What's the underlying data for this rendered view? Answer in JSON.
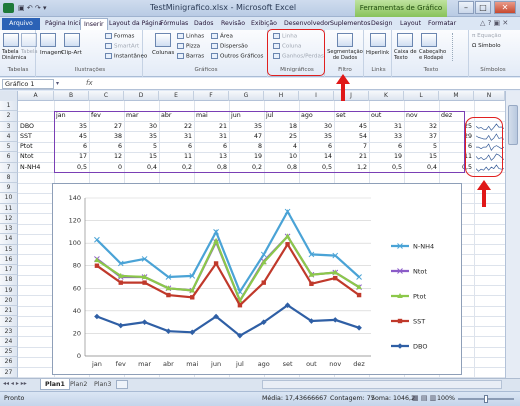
{
  "window": {
    "title": "TestMinigrafico.xlsx - Microsoft Excel",
    "context_tab": "Ferramentas de Gráfico",
    "minimize": "–",
    "maximize": "□",
    "close": "✕"
  },
  "tabs": [
    "Arquivo",
    "Página Inicial",
    "Inserir",
    "Layout da Página",
    "Fórmulas",
    "Dados",
    "Revisão",
    "Exibição",
    "Desenvolvedor",
    "Suplementos",
    "Design",
    "Layout",
    "Formatar"
  ],
  "ribbon": {
    "tabelas": {
      "label": "Tabelas",
      "items": [
        "Tabela Dinâmica",
        "Tabela"
      ]
    },
    "ilustracoes": {
      "label": "Ilustrações",
      "items": [
        "Imagem",
        "Clip-Art",
        "Formas",
        "SmartArt",
        "Instantâneo"
      ]
    },
    "graficos": {
      "label": "Gráficos",
      "items": [
        "Colunas",
        "Linhas",
        "Pizza",
        "Barras",
        "Área",
        "Dispersão",
        "Outros Gráficos"
      ]
    },
    "minigraficos": {
      "label": "Minigráficos",
      "items": [
        "Linha",
        "Coluna",
        "Ganhos/Perdas"
      ]
    },
    "filtro": {
      "label": "Filtro",
      "items": [
        "Segmentação de Dados"
      ]
    },
    "links": {
      "label": "Links",
      "items": [
        "Hiperlink"
      ]
    },
    "texto": {
      "label": "Texto",
      "items": [
        "Caixa de Texto",
        "Cabeçalho e Rodapé"
      ]
    },
    "simbolos": {
      "label": "Símbolos",
      "items": [
        "Equação",
        "Símbolo"
      ]
    }
  },
  "formula_bar": {
    "namebox": "Gráfico 1",
    "fx": "fx",
    "value": ""
  },
  "columns": [
    "A",
    "B",
    "C",
    "D",
    "E",
    "F",
    "G",
    "H",
    "I",
    "J",
    "K",
    "L",
    "M",
    "N"
  ],
  "rows": [
    "1",
    "2",
    "3",
    "4",
    "5",
    "6",
    "7",
    "8",
    "9",
    "10",
    "11",
    "12",
    "13",
    "14",
    "15",
    "16",
    "17",
    "18",
    "19",
    "20",
    "21",
    "22",
    "23",
    "24",
    "25",
    "26",
    "27",
    "28"
  ],
  "table": {
    "months": [
      "jan",
      "fev",
      "mar",
      "abr",
      "mai",
      "jun",
      "jul",
      "ago",
      "set",
      "out",
      "nov",
      "dez"
    ],
    "rows": [
      {
        "label": "DBO",
        "values": [
          "35",
          "27",
          "30",
          "22",
          "21",
          "35",
          "18",
          "30",
          "45",
          "31",
          "32",
          "25"
        ]
      },
      {
        "label": "SST",
        "values": [
          "45",
          "38",
          "35",
          "31",
          "31",
          "47",
          "25",
          "35",
          "54",
          "33",
          "37",
          "29"
        ]
      },
      {
        "label": "Ptot",
        "values": [
          "6",
          "6",
          "5",
          "6",
          "6",
          "8",
          "4",
          "6",
          "7",
          "6",
          "5",
          "6"
        ]
      },
      {
        "label": "Ntot",
        "values": [
          "17",
          "12",
          "15",
          "11",
          "13",
          "19",
          "10",
          "14",
          "21",
          "19",
          "15",
          "11"
        ]
      },
      {
        "label": "N-NH4",
        "values": [
          "0,5",
          "0",
          "0,4",
          "0,2",
          "0,8",
          "0,2",
          "0,8",
          "0,5",
          "1,2",
          "0,5",
          "0,4",
          "0,5"
        ]
      }
    ]
  },
  "chart_data": {
    "type": "line",
    "categories": [
      "jan",
      "fev",
      "mar",
      "abr",
      "mai",
      "jun",
      "jul",
      "ago",
      "set",
      "out",
      "nov",
      "dez"
    ],
    "ylim": [
      0,
      140
    ],
    "yticks": [
      "0",
      "20",
      "40",
      "60",
      "80",
      "100",
      "120",
      "140"
    ],
    "legend_position": "right",
    "series": [
      {
        "name": "N-NH4",
        "color": "#4aa3d6",
        "marker": "x",
        "values": [
          103,
          82,
          86,
          70,
          71,
          110,
          57,
          90,
          128,
          90,
          89,
          70
        ]
      },
      {
        "name": "Ntot",
        "color": "#8b5cc8",
        "marker": "x",
        "values": [
          86,
          70,
          70,
          60,
          58,
          101,
          49,
          84,
          106,
          72,
          74,
          61
        ]
      },
      {
        "name": "Ptot",
        "color": "#8cc84a",
        "marker": "triangle",
        "values": [
          85,
          71,
          70,
          60,
          58,
          102,
          49,
          83,
          106,
          72,
          74,
          61
        ]
      },
      {
        "name": "SST",
        "color": "#c0392b",
        "marker": "square",
        "values": [
          80,
          65,
          65,
          54,
          52,
          82,
          45,
          65,
          99,
          64,
          69,
          54
        ]
      },
      {
        "name": "DBO",
        "color": "#2f5fa5",
        "marker": "diamond",
        "values": [
          35,
          27,
          30,
          22,
          21,
          35,
          18,
          30,
          45,
          31,
          32,
          25
        ]
      }
    ]
  },
  "sheet_tabs": [
    "Plan1",
    "Plan2",
    "Plan3"
  ],
  "status": {
    "mode": "Pronto",
    "media": "Média: 17,43666667",
    "contagem": "Contagem: 77",
    "soma": "Soma: 1046,2",
    "zoom": "100%"
  }
}
